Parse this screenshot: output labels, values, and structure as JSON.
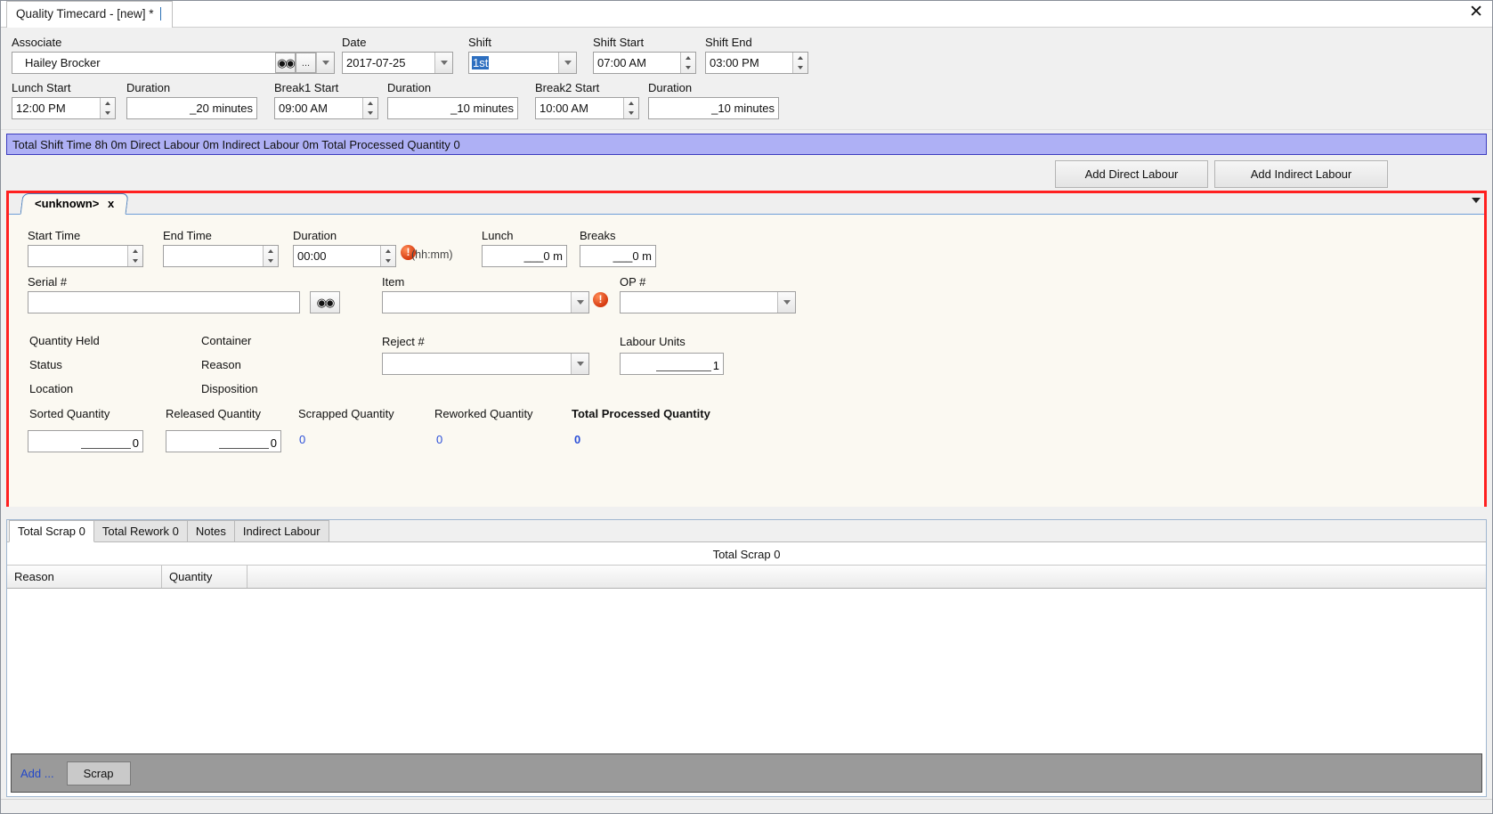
{
  "window": {
    "tab_title": "Quality Timecard - [new] *",
    "close_icon": "close-icon"
  },
  "header": {
    "associate": {
      "label": "Associate",
      "value": "Hailey Brocker",
      "find_icon": "binoculars-icon",
      "ellipsis_label": "...",
      "dropdown_icon": "chevron-down-icon"
    },
    "date": {
      "label": "Date",
      "value": "2017-07-25"
    },
    "shift": {
      "label": "Shift",
      "value": "1st"
    },
    "shift_start": {
      "label": "Shift Start",
      "value": "07:00 AM"
    },
    "shift_end": {
      "label": "Shift End",
      "value": "03:00 PM"
    },
    "lunch_start": {
      "label": "Lunch Start",
      "value": "12:00 PM"
    },
    "lunch_duration": {
      "label": "Duration",
      "value": "_20 minutes"
    },
    "break1_start": {
      "label": "Break1 Start",
      "value": "09:00 AM"
    },
    "break1_duration": {
      "label": "Duration",
      "value": "_10 minutes"
    },
    "break2_start": {
      "label": "Break2 Start",
      "value": "10:00 AM"
    },
    "break2_duration": {
      "label": "Duration",
      "value": "_10 minutes"
    }
  },
  "summary": {
    "text": "Total Shift Time 8h 0m  Direct Labour 0m  Indirect Labour 0m  Total Processed Quantity 0"
  },
  "actions": {
    "add_direct_labour": "Add Direct Labour",
    "add_indirect_labour": "Add Indirect Labour"
  },
  "labour_tab": {
    "title": "<unknown>",
    "close_label": "x",
    "overflow_icon": "chevron-down-icon"
  },
  "labour_form": {
    "start_time": {
      "label": "Start Time",
      "value": ""
    },
    "end_time": {
      "label": "End Time",
      "value": ""
    },
    "duration": {
      "label": "Duration",
      "value": "00:00",
      "hint": "(hh:mm)",
      "error_icon": "error-icon"
    },
    "lunch": {
      "label": "Lunch",
      "value": "___0 m"
    },
    "breaks": {
      "label": "Breaks",
      "value": "___0 m"
    },
    "serial": {
      "label": "Serial #",
      "value": "",
      "find_icon": "binoculars-icon"
    },
    "item": {
      "label": "Item",
      "value": "",
      "error_icon": "error-icon"
    },
    "op": {
      "label": "OP #",
      "value": ""
    },
    "quantity_held": {
      "label": "Quantity Held"
    },
    "container": {
      "label": "Container"
    },
    "status": {
      "label": "Status"
    },
    "reason": {
      "label": "Reason"
    },
    "location": {
      "label": "Location"
    },
    "disposition": {
      "label": "Disposition"
    },
    "reject": {
      "label": "Reject #",
      "value": ""
    },
    "labour_units": {
      "label": "Labour Units",
      "value": "1"
    },
    "sorted_quantity": {
      "label": "Sorted Quantity",
      "value": "0"
    },
    "released_quantity": {
      "label": "Released Quantity",
      "value": "0"
    },
    "scrapped_quantity": {
      "label": "Scrapped Quantity",
      "value": "0"
    },
    "reworked_quantity": {
      "label": "Reworked Quantity",
      "value": "0"
    },
    "total_processed_quantity": {
      "label": "Total Processed Quantity",
      "value": "0"
    }
  },
  "bottom": {
    "tabs": [
      {
        "label": "Total Scrap 0",
        "active": true
      },
      {
        "label": "Total Rework 0",
        "active": false
      },
      {
        "label": "Notes",
        "active": false
      },
      {
        "label": "Indirect Labour",
        "active": false
      }
    ],
    "grid_title": "Total Scrap 0",
    "columns": [
      "Reason",
      "Quantity"
    ],
    "rows": [],
    "footer": {
      "add_label": "Add ...",
      "scrap_label": "Scrap"
    }
  },
  "colors": {
    "accent_red": "#ff2020",
    "summary_bg": "#aeb0f5",
    "link_blue": "#2348c8",
    "value_blue": "#2b4fd8"
  }
}
